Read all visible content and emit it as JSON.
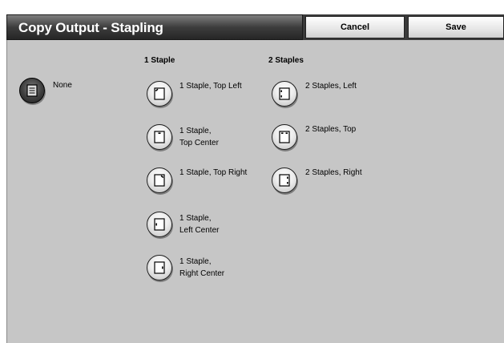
{
  "header": {
    "title": "Copy Output - Stapling",
    "cancel_label": "Cancel",
    "save_label": "Save"
  },
  "none_option": {
    "label": "None",
    "icon": "page-icon",
    "selected": true
  },
  "one_staple": {
    "heading": "1 Staple",
    "options": [
      {
        "line1": "1 Staple, Top Left",
        "line2": "",
        "icon": "staple-top-left-icon"
      },
      {
        "line1": "1 Staple,",
        "line2": "Top Center",
        "icon": "staple-top-center-icon"
      },
      {
        "line1": "1 Staple, Top Right",
        "line2": "",
        "icon": "staple-top-right-icon"
      },
      {
        "line1": "1 Staple,",
        "line2": "Left Center",
        "icon": "staple-left-center-icon"
      },
      {
        "line1": "1 Staple,",
        "line2": "Right Center",
        "icon": "staple-right-center-icon"
      }
    ]
  },
  "two_staples": {
    "heading": "2 Staples",
    "options": [
      {
        "label": "2 Staples, Left",
        "icon": "two-staples-left-icon"
      },
      {
        "label": "2 Staples, Top",
        "icon": "two-staples-top-icon"
      },
      {
        "label": "2 Staples, Right",
        "icon": "two-staples-right-icon"
      }
    ]
  }
}
